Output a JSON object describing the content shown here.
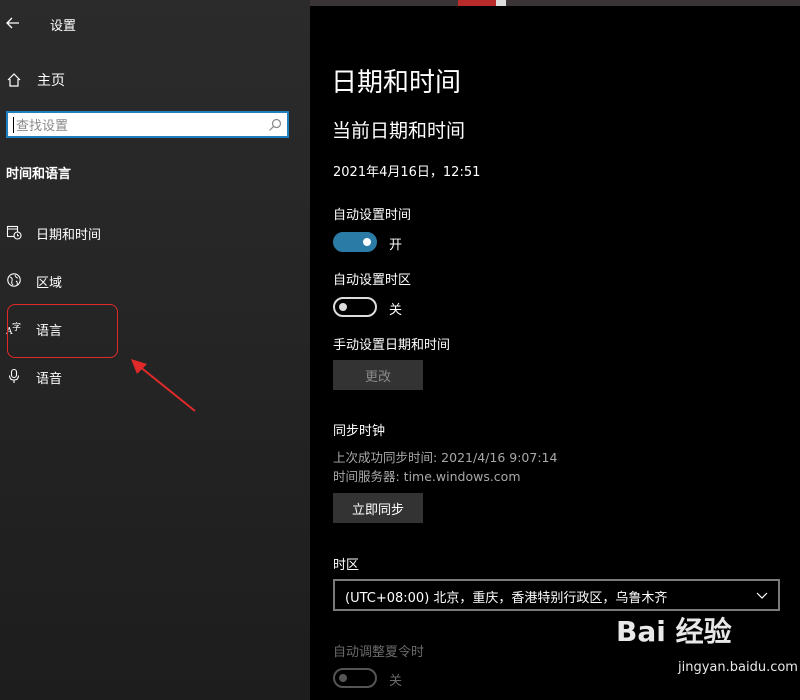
{
  "window": {
    "title": "设置"
  },
  "sidebar": {
    "home_label": "主页",
    "search_placeholder": "查找设置",
    "section_title": "时间和语言",
    "items": [
      {
        "label": "日期和时间",
        "icon": "calendar-clock-icon"
      },
      {
        "label": "区域",
        "icon": "globe-icon"
      },
      {
        "label": "语言",
        "icon": "language-icon"
      },
      {
        "label": "语音",
        "icon": "microphone-icon"
      }
    ]
  },
  "main": {
    "title": "日期和时间",
    "subtitle": "当前日期和时间",
    "current_datetime": "2021年4月16日，12:51",
    "auto_time": {
      "label": "自动设置时间",
      "state": "开",
      "on": true
    },
    "auto_timezone": {
      "label": "自动设置时区",
      "state": "关",
      "on": false
    },
    "manual": {
      "label": "手动设置日期和时间",
      "button": "更改"
    },
    "sync": {
      "title": "同步时钟",
      "last_sync": "上次成功同步时间: 2021/4/16 9:07:14",
      "server": "时间服务器: time.windows.com",
      "button": "立即同步"
    },
    "timezone": {
      "label": "时区",
      "value": "(UTC+08:00) 北京，重庆，香港特别行政区，乌鲁木齐"
    },
    "dst": {
      "label": "自动调整夏令时",
      "state": "关",
      "on": false
    }
  },
  "watermark": {
    "logo": "Bai 经验",
    "url": "jingyan.baidu.com"
  },
  "colors": {
    "accent": "#2a7ca6",
    "annotation": "#e02a2a",
    "focus_border": "#1f7fbf"
  }
}
